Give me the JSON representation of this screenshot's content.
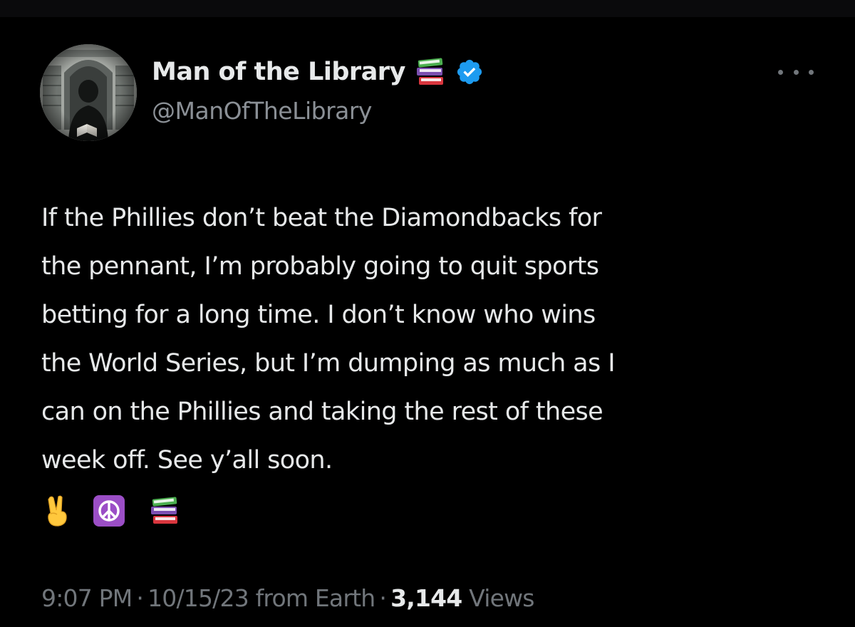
{
  "author": {
    "display_name": "Man of the Library",
    "handle": "@ManOfTheLibrary",
    "name_emoji_icon": "books-icon",
    "verified_icon": "verified-badge-icon",
    "verified_color": "#1d9bf0"
  },
  "more_icon": "more-options-icon",
  "tweet": {
    "lines": [
      "If the Phillies don’t beat the Diamondbacks for",
      "the pennant, I’m probably going to quit sports",
      "betting for a long time. I don’t know who wins",
      "the World Series, but I’m dumping as much as I",
      "can on the Phillies and taking the rest of these",
      "week off. See y’all soon."
    ],
    "emojis": [
      "victory-hand-icon",
      "peace-symbol-icon",
      "books-icon"
    ]
  },
  "meta": {
    "time": "9:07 PM",
    "separator": "·",
    "date": "10/15/23",
    "source": "from Earth",
    "views_count": "3,144",
    "views_label": "Views"
  },
  "colors": {
    "background": "#000000",
    "text_primary": "#e7e9ea",
    "text_secondary": "#71767b",
    "verified_blue": "#1d9bf0"
  }
}
